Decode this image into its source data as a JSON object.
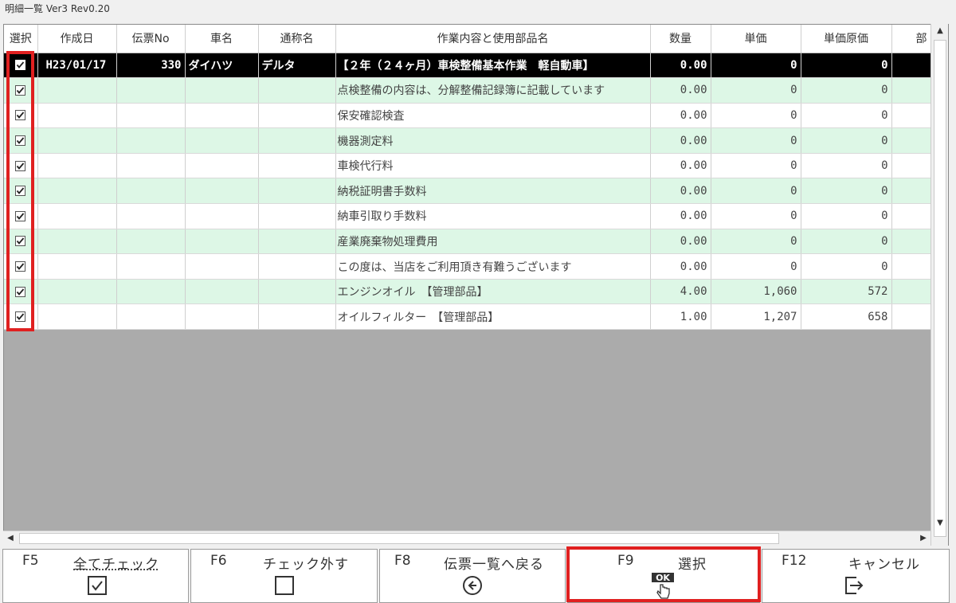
{
  "window": {
    "title": "明細一覧 Ver3 Rev0.20"
  },
  "columns": [
    "選択",
    "作成日",
    "伝票No",
    "車名",
    "通称名",
    "作業内容と使用部品名",
    "数量",
    "単価",
    "単価原価",
    "部"
  ],
  "rows": [
    {
      "checked": true,
      "date": "H23/01/17",
      "slip_no": "330",
      "car_name": "ダイハツ",
      "nickname": "デルタ",
      "description": "【２年（２４ヶ月）車検整備基本作業　軽自動車】",
      "qty": "0.00",
      "unit_price": "0",
      "unit_cost": "0"
    },
    {
      "checked": true,
      "date": "",
      "slip_no": "",
      "car_name": "",
      "nickname": "",
      "description": "点検整備の内容は、分解整備記録簿に記載しています",
      "qty": "0.00",
      "unit_price": "0",
      "unit_cost": "0"
    },
    {
      "checked": true,
      "date": "",
      "slip_no": "",
      "car_name": "",
      "nickname": "",
      "description": "保安確認検査",
      "qty": "0.00",
      "unit_price": "0",
      "unit_cost": "0"
    },
    {
      "checked": true,
      "date": "",
      "slip_no": "",
      "car_name": "",
      "nickname": "",
      "description": "機器測定料",
      "qty": "0.00",
      "unit_price": "0",
      "unit_cost": "0"
    },
    {
      "checked": true,
      "date": "",
      "slip_no": "",
      "car_name": "",
      "nickname": "",
      "description": "車検代行料",
      "qty": "0.00",
      "unit_price": "0",
      "unit_cost": "0"
    },
    {
      "checked": true,
      "date": "",
      "slip_no": "",
      "car_name": "",
      "nickname": "",
      "description": "納税証明書手数料",
      "qty": "0.00",
      "unit_price": "0",
      "unit_cost": "0"
    },
    {
      "checked": true,
      "date": "",
      "slip_no": "",
      "car_name": "",
      "nickname": "",
      "description": "納車引取り手数料",
      "qty": "0.00",
      "unit_price": "0",
      "unit_cost": "0"
    },
    {
      "checked": true,
      "date": "",
      "slip_no": "",
      "car_name": "",
      "nickname": "",
      "description": "産業廃棄物処理費用",
      "qty": "0.00",
      "unit_price": "0",
      "unit_cost": "0"
    },
    {
      "checked": true,
      "date": "",
      "slip_no": "",
      "car_name": "",
      "nickname": "",
      "description": "この度は、当店をご利用頂き有難うございます",
      "qty": "0.00",
      "unit_price": "0",
      "unit_cost": "0"
    },
    {
      "checked": true,
      "date": "",
      "slip_no": "",
      "car_name": "",
      "nickname": "",
      "description": "エンジンオイル　【管理部品】",
      "qty": "4.00",
      "unit_price": "1,060",
      "unit_cost": "572"
    },
    {
      "checked": true,
      "date": "",
      "slip_no": "",
      "car_name": "",
      "nickname": "",
      "description": "オイルフィルター　【管理部品】",
      "qty": "1.00",
      "unit_price": "1,207",
      "unit_cost": "658"
    }
  ],
  "function_buttons": [
    {
      "key": "F5",
      "label": "全てチェック",
      "icon": "checked-box-icon"
    },
    {
      "key": "F6",
      "label": "チェック外す",
      "icon": "empty-box-icon"
    },
    {
      "key": "F8",
      "label": "伝票一覧へ戻る",
      "icon": "back-arrow-circle-icon"
    },
    {
      "key": "F9",
      "label": "選択",
      "icon": "ok-hand-icon",
      "icon_text": "OK"
    },
    {
      "key": "F12",
      "label": "キャンセル",
      "icon": "exit-icon"
    }
  ],
  "colors": {
    "highlight": "#e02020",
    "row_alt": "#ddf7e6",
    "selected_row": "#000000"
  }
}
